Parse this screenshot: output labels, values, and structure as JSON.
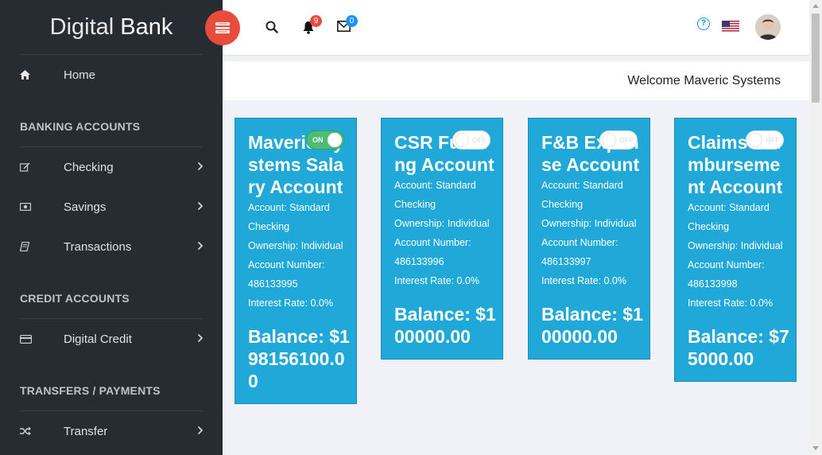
{
  "brand": {
    "part1": "Digital",
    "part2": "Bank"
  },
  "sidebar": {
    "home": "Home",
    "sections": [
      {
        "title": "BANKING ACCOUNTS",
        "items": [
          "Checking",
          "Savings",
          "Transactions"
        ]
      },
      {
        "title": "CREDIT ACCOUNTS",
        "items": [
          "Digital Credit"
        ]
      },
      {
        "title": "TRANSFERS / PAYMENTS",
        "items": [
          "Transfer"
        ]
      }
    ]
  },
  "header": {
    "notifications_count": "9",
    "messages_count": "0",
    "welcome": "Welcome Maveric Systems",
    "help_glyph": "?"
  },
  "colors": {
    "card": "#20a8d8",
    "toggle_on": "#4dbd74",
    "menu_button": "#e74c3c",
    "badge_red": "#e74c3c",
    "badge_blue": "#1e90ff"
  },
  "accounts": [
    {
      "title": "Maveric Systems Salary Account",
      "toggle": "ON",
      "account": "Account: Standard Checking",
      "ownership": "Ownership: Individual",
      "number_label": "Account Number:",
      "number": "486133995",
      "interest": "Interest Rate: 0.0%",
      "balance": "Balance: $198156100.00"
    },
    {
      "title": "CSR Funding Account",
      "toggle": "OFF",
      "account": "Account: Standard Checking",
      "ownership": "Ownership: Individual",
      "number_label": "Account Number:",
      "number": "486133996",
      "interest": "Interest Rate: 0.0%",
      "balance": "Balance: $100000.00"
    },
    {
      "title": "F&B Expense Account",
      "toggle": "OFF",
      "account": "Account: Standard Checking",
      "ownership": "Ownership: Individual",
      "number_label": "Account Number:",
      "number": "486133997",
      "interest": "Interest Rate: 0.0%",
      "balance": "Balance: $100000.00"
    },
    {
      "title": "Claims Reimbursement Account",
      "toggle": "OFF",
      "account": "Account: Standard Checking",
      "ownership": "Ownership: Individual",
      "number_label": "Account Number:",
      "number": "486133998",
      "interest": "Interest Rate: 0.0%",
      "balance": "Balance: $75000.00"
    }
  ]
}
